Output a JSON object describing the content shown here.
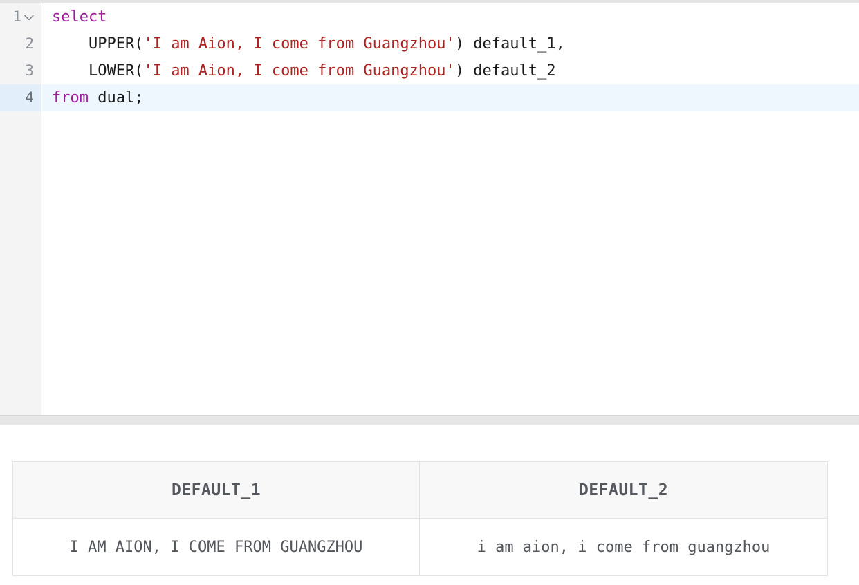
{
  "editor": {
    "active_line": 4,
    "keyword_color": "#9c1f9c",
    "string_color": "#b02121",
    "text_color": "#1b1b1b",
    "active_line_bg": "#eff7fe",
    "gutter_bg": "#f4f4f4",
    "fold_icon": "chevron-down-icon",
    "lines": [
      {
        "number": "1",
        "has_fold": true,
        "tokens": [
          {
            "text": "select",
            "type": "kw"
          }
        ]
      },
      {
        "number": "2",
        "has_fold": false,
        "tokens": [
          {
            "text": "    UPPER(",
            "type": "fn"
          },
          {
            "text": "'I am Aion, I come from Guangzhou'",
            "type": "str"
          },
          {
            "text": ") default_1,",
            "type": "id"
          }
        ]
      },
      {
        "number": "3",
        "has_fold": false,
        "tokens": [
          {
            "text": "    LOWER(",
            "type": "fn"
          },
          {
            "text": "'I am Aion, I come from Guangzhou'",
            "type": "str"
          },
          {
            "text": ") default_2",
            "type": "id"
          }
        ]
      },
      {
        "number": "4",
        "has_fold": false,
        "tokens": [
          {
            "text": "from",
            "type": "kw"
          },
          {
            "text": " dual;",
            "type": "id"
          }
        ]
      }
    ],
    "full_sql": "select\n    UPPER('I am Aion, I come from Guangzhou') default_1,\n    LOWER('I am Aion, I come from Guangzhou') default_2\nfrom dual;"
  },
  "results": {
    "columns": [
      "DEFAULT_1",
      "DEFAULT_2"
    ],
    "rows": [
      [
        "I AM AION, I COME FROM GUANGZHOU",
        "i am aion, i come from guangzhou"
      ]
    ]
  }
}
